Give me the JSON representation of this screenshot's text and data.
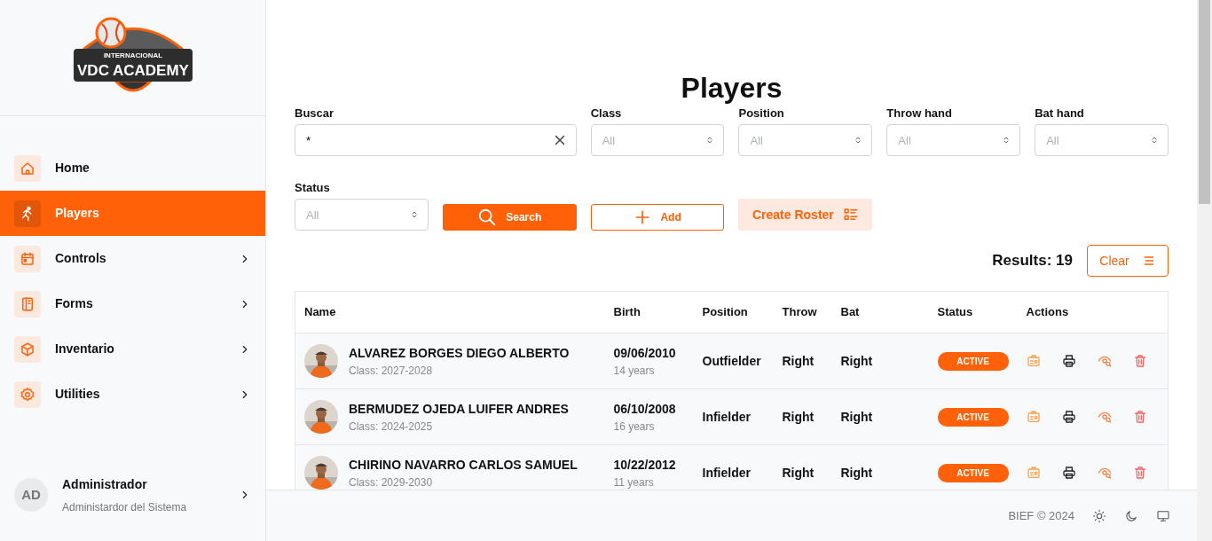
{
  "sidebar": {
    "logo": {
      "title": "VDC ACADEMY",
      "subtitle": "INTERNACIONAL"
    },
    "items": [
      {
        "label": "Home",
        "kind": "home",
        "selected": false,
        "submenu": false
      },
      {
        "label": "Players",
        "kind": "players",
        "selected": true,
        "submenu": false
      },
      {
        "label": "Controls",
        "kind": "calendar",
        "selected": false,
        "submenu": true
      },
      {
        "label": "Forms",
        "kind": "forms",
        "selected": false,
        "submenu": true
      },
      {
        "label": "Inventario",
        "kind": "box",
        "selected": false,
        "submenu": true
      },
      {
        "label": "Utilities",
        "kind": "gear",
        "selected": false,
        "submenu": true
      }
    ],
    "user": {
      "initials": "AD",
      "name": "Administrador",
      "role": "Administardor del Sistema"
    }
  },
  "page": {
    "title": "Players",
    "filters": [
      {
        "label": "Buscar",
        "kind": "search",
        "value": "*"
      },
      {
        "label": "Class",
        "kind": "select",
        "placeholder": "All"
      },
      {
        "label": "Position",
        "kind": "select",
        "placeholder": "All"
      },
      {
        "label": "Throw hand",
        "kind": "select",
        "placeholder": "All"
      },
      {
        "label": "Bat hand",
        "kind": "select",
        "placeholder": "All"
      },
      {
        "label": "Status",
        "kind": "select",
        "placeholder": "All"
      }
    ],
    "buttons": [
      {
        "label": "Search",
        "kind": "primary"
      },
      {
        "label": "Add",
        "kind": "outline"
      },
      {
        "label": "Create Roster",
        "kind": "soft"
      }
    ],
    "results": "Results: 19",
    "clear_button": "Clear",
    "table": {
      "columns": [
        "Name",
        "Birth",
        "Position",
        "Throw",
        "Bat",
        "Status",
        "Actions"
      ],
      "rows": [
        {
          "name": "ALVAREZ BORGES DIEGO ALBERTO",
          "class": "Class: 2027-2028",
          "birth": "09/06/2010",
          "age": "14 years",
          "position": "Outfielder",
          "throw": "Right",
          "bat": "Right",
          "status": "ACTIVE"
        },
        {
          "name": "BERMUDEZ OJEDA LUIFER ANDRES",
          "class": "Class: 2024-2025",
          "birth": "06/10/2008",
          "age": "16 years",
          "position": "Infielder",
          "throw": "Right",
          "bat": "Right",
          "status": "ACTIVE"
        },
        {
          "name": "CHIRINO NAVARRO CARLOS SAMUEL",
          "class": "Class: 2029-2030",
          "birth": "10/22/2012",
          "age": "11 years",
          "position": "Infielder",
          "throw": "Right",
          "bat": "Right",
          "status": "ACTIVE"
        }
      ]
    }
  },
  "footer": {
    "text": "BIEF © 2024"
  }
}
